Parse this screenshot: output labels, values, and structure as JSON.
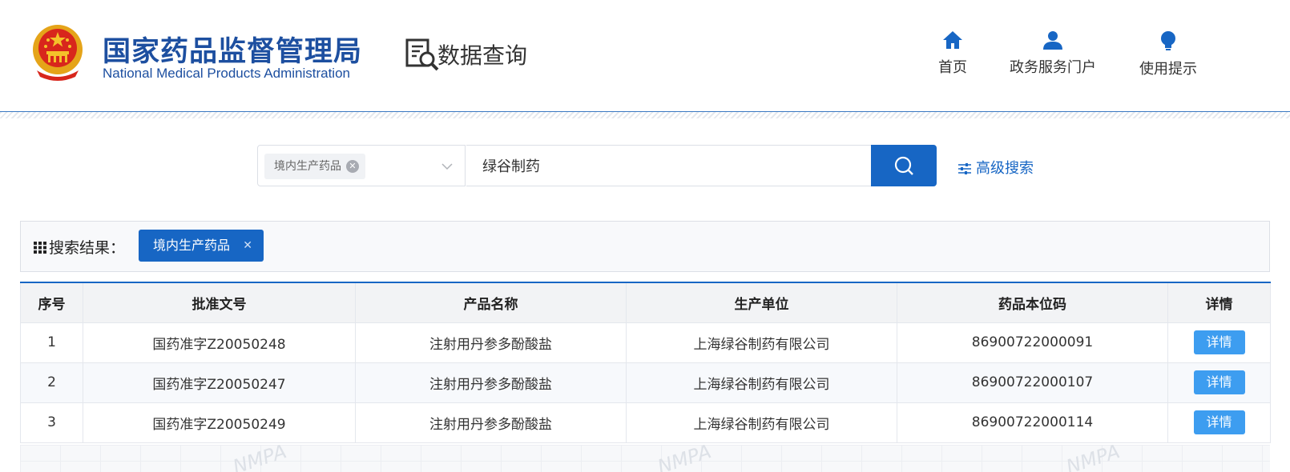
{
  "header": {
    "title_cn": "国家药品监督管理局",
    "title_en": "National Medical Products Administration",
    "section_title": "数据查询",
    "nav": [
      {
        "label": "首页",
        "icon": "home-icon"
      },
      {
        "label": "政务服务门户",
        "icon": "user-icon"
      },
      {
        "label": "使用提示",
        "icon": "lightbulb-icon"
      }
    ]
  },
  "search": {
    "category_tag": "境内生产药品",
    "query": "绿谷制药",
    "advanced_label": "高级搜索"
  },
  "results": {
    "label": "搜索结果：",
    "filter_tag": "境内生产药品",
    "columns": [
      "序号",
      "批准文号",
      "产品名称",
      "生产单位",
      "药品本位码",
      "详情"
    ],
    "rows": [
      {
        "index": "1",
        "approval": "国药准字Z20050248",
        "product": "注射用丹参多酚酸盐",
        "maker": "上海绿谷制药有限公司",
        "code": "86900722000091",
        "action": "详情"
      },
      {
        "index": "2",
        "approval": "国药准字Z20050247",
        "product": "注射用丹参多酚酸盐",
        "maker": "上海绿谷制药有限公司",
        "code": "86900722000107",
        "action": "详情"
      },
      {
        "index": "3",
        "approval": "国药准字Z20050249",
        "product": "注射用丹参多酚酸盐",
        "maker": "上海绿谷制药有限公司",
        "code": "86900722000114",
        "action": "详情"
      }
    ]
  },
  "watermark": "NMPA",
  "colors": {
    "primary": "#1766c4",
    "brand": "#1d4fa0",
    "detail_button": "#3d9df0"
  }
}
